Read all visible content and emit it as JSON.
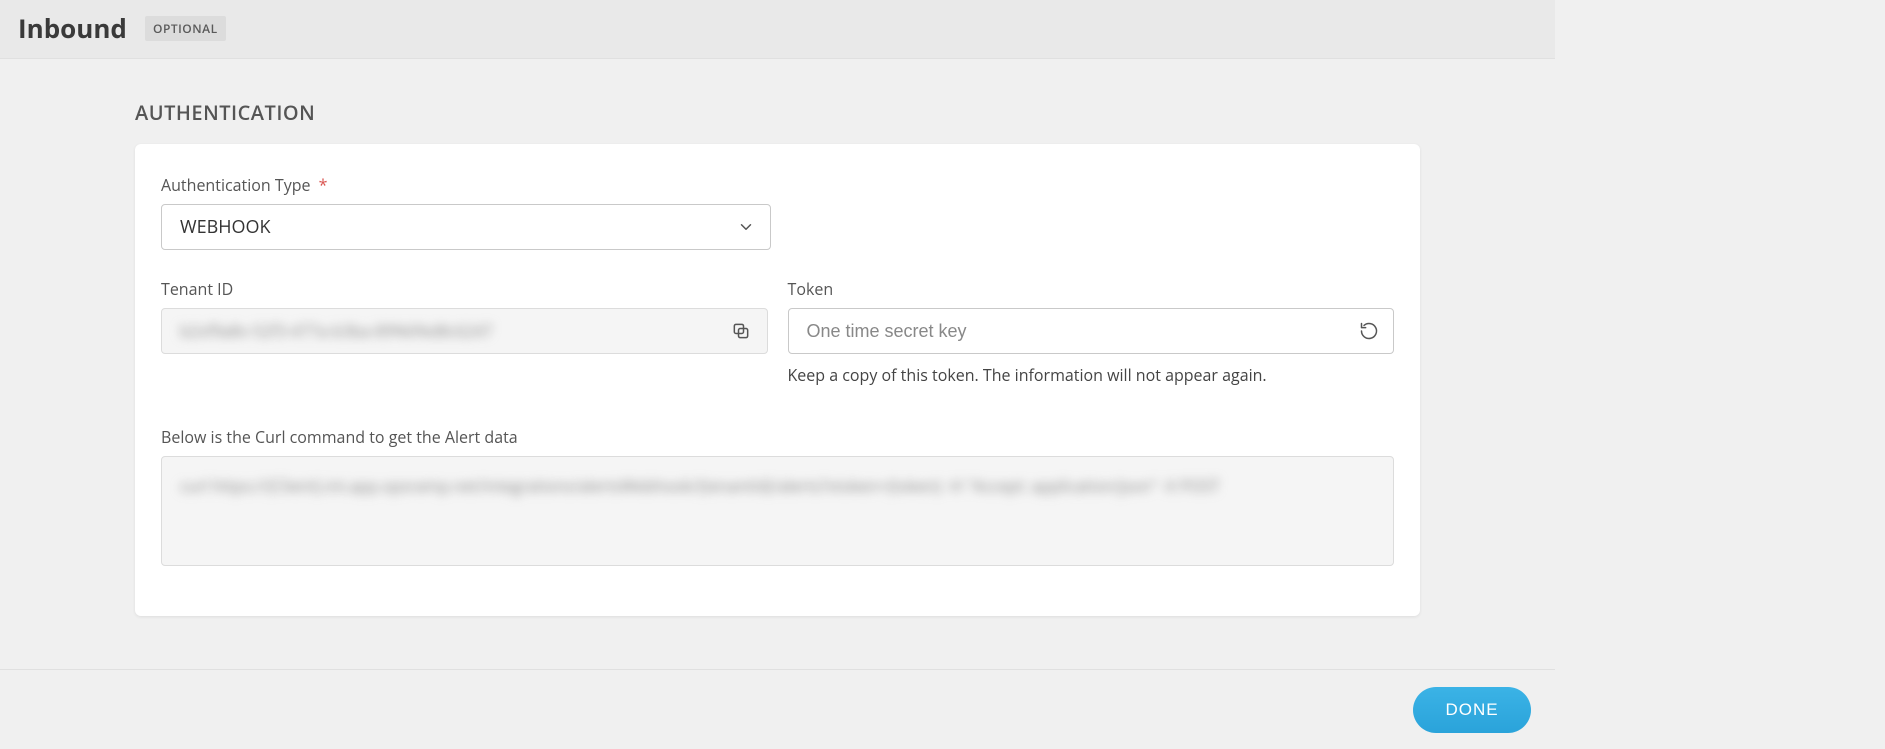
{
  "header": {
    "title": "Inbound",
    "badge": "OPTIONAL"
  },
  "section": {
    "title": "AUTHENTICATION",
    "auth_type": {
      "label": "Authentication Type",
      "required_mark": "*",
      "value": "WEBHOOK"
    },
    "tenant": {
      "label": "Tenant ID",
      "value_masked": "b2xf9a8v-52f3-477a-b3ba-89%6%d8c6247"
    },
    "token": {
      "label": "Token",
      "placeholder": "One time secret key",
      "helper": "Keep a copy of this token. The information will not appear again."
    },
    "curl": {
      "label": "Below is the Curl command to get the Alert data",
      "masked": "curl https://{Client}.int.app.opsramp.net/integrations/alertsWebhook/{tenantId}/alerts?vtoken={token} -H \"Accept: application/json\" -X POST"
    }
  },
  "footer": {
    "done_label": "DONE"
  }
}
